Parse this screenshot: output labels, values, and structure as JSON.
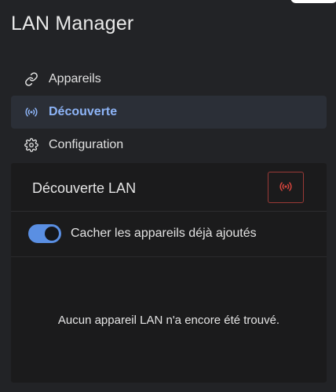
{
  "app": {
    "title": "LAN Manager"
  },
  "nav": {
    "items": [
      {
        "label": "Appareils",
        "icon": "link-icon",
        "active": false
      },
      {
        "label": "Découverte",
        "icon": "broadcast-icon",
        "active": true
      },
      {
        "label": "Configuration",
        "icon": "gear-icon",
        "active": false
      }
    ]
  },
  "card": {
    "title": "Découverte LAN",
    "scan_button_icon": "broadcast-icon",
    "toggle": {
      "label": "Cacher les appareils déjà ajoutés",
      "on": true
    },
    "empty_message": "Aucun appareil LAN n'a encore été trouvé."
  },
  "colors": {
    "accent": "#8db4f7",
    "toggle_on": "#5a8fe3",
    "danger": "#d7453d",
    "active_nav_bg": "#2b2f37"
  }
}
